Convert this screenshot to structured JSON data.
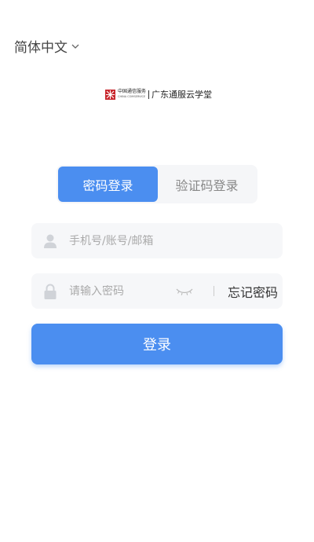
{
  "language": {
    "label": "简体中文",
    "icon": "chevron-down-icon"
  },
  "logo": {
    "org_cn": "中国通信服务",
    "org_en": "CHINA COMSERVICE",
    "app_name": "广东通服云学堂"
  },
  "tabs": [
    {
      "label": "密码登录",
      "active": true
    },
    {
      "label": "验证码登录",
      "active": false
    }
  ],
  "account_field": {
    "placeholder": "手机号/账号/邮箱",
    "value": "",
    "icon": "user-icon"
  },
  "password_field": {
    "placeholder": "请输入密码",
    "value": "",
    "icon": "lock-icon",
    "toggle_icon": "eye-closed-icon"
  },
  "forgot_password": "忘记密码",
  "login_button": "登录",
  "colors": {
    "accent": "#4b8ef0",
    "field_bg": "#f6f7f9",
    "tab_bg": "#f5f6f8"
  }
}
